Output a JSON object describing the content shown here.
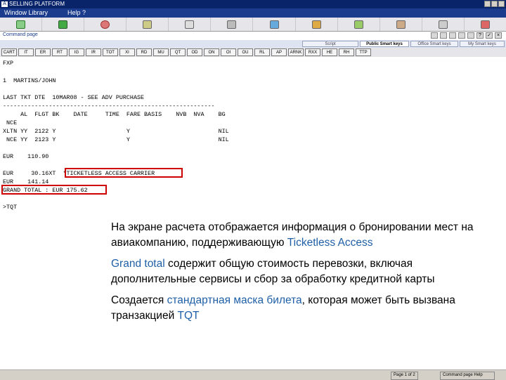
{
  "window": {
    "title": "SELLING PLATFORM"
  },
  "menubar": {
    "window_label": "Window Library",
    "help_label": "Help ?"
  },
  "toolbar_icons": [
    "folder-icon",
    "document-icon",
    "user-icon",
    "tools-icon",
    "printer-icon",
    "train-icon",
    "car-icon",
    "pencil-icon",
    "map-icon",
    "hotel-icon",
    "plane-icon",
    "clipboard-icon"
  ],
  "command_page": {
    "title": "Command page"
  },
  "tabs": [
    "Script",
    "Public Smart keys",
    "Office Smart keys",
    "My Smart keys"
  ],
  "quick_buttons": [
    "CART",
    "IT",
    "ER",
    "RT",
    "IG",
    "IR",
    "TOT",
    "XI",
    "RD",
    "MU",
    "QT",
    "OD",
    "ON",
    "OI",
    "OU",
    "RL",
    "AP",
    "ARNK",
    "RXX",
    "HE",
    "RH",
    "TTP"
  ],
  "terminal": {
    "lines": [
      "FXP",
      "1  MARTINS/JOHN",
      "LAST TKT DTE  10MAR08 - SEE ADV PURCHASE",
      "------------------------------------------------------------",
      "     AL  FLGT BK    DATE     TIME  FARE BASIS    NVB  NVA    BG",
      " NCE",
      "XLTN YY  2122 Y                    Y                         NIL",
      " NCE YY  2123 Y                    Y                         NIL",
      "EUR    110.90",
      "EUR     30.16XT  *TICKETLESS ACCESS CARRIER",
      "EUR    141.14",
      "GRAND TOTAL : EUR 175.62",
      ">TQT"
    ]
  },
  "statusbar": {
    "page": "Page 1 of 2",
    "help": "Command page Help"
  },
  "note": {
    "p1": [
      "На экране расчета отображается информация о бронировании мест на авиакомпанию, поддерживающую ",
      "Ticketless Access"
    ],
    "p2": [
      "Grand total",
      " содержит общую стоимость перевозки, включая дополнительные сервисы и сбор за обработку кредитной карты"
    ],
    "p3": [
      "Создается ",
      "стандартная маска билета",
      ", которая может быть вызвана транзакцией ",
      "TQT"
    ]
  }
}
